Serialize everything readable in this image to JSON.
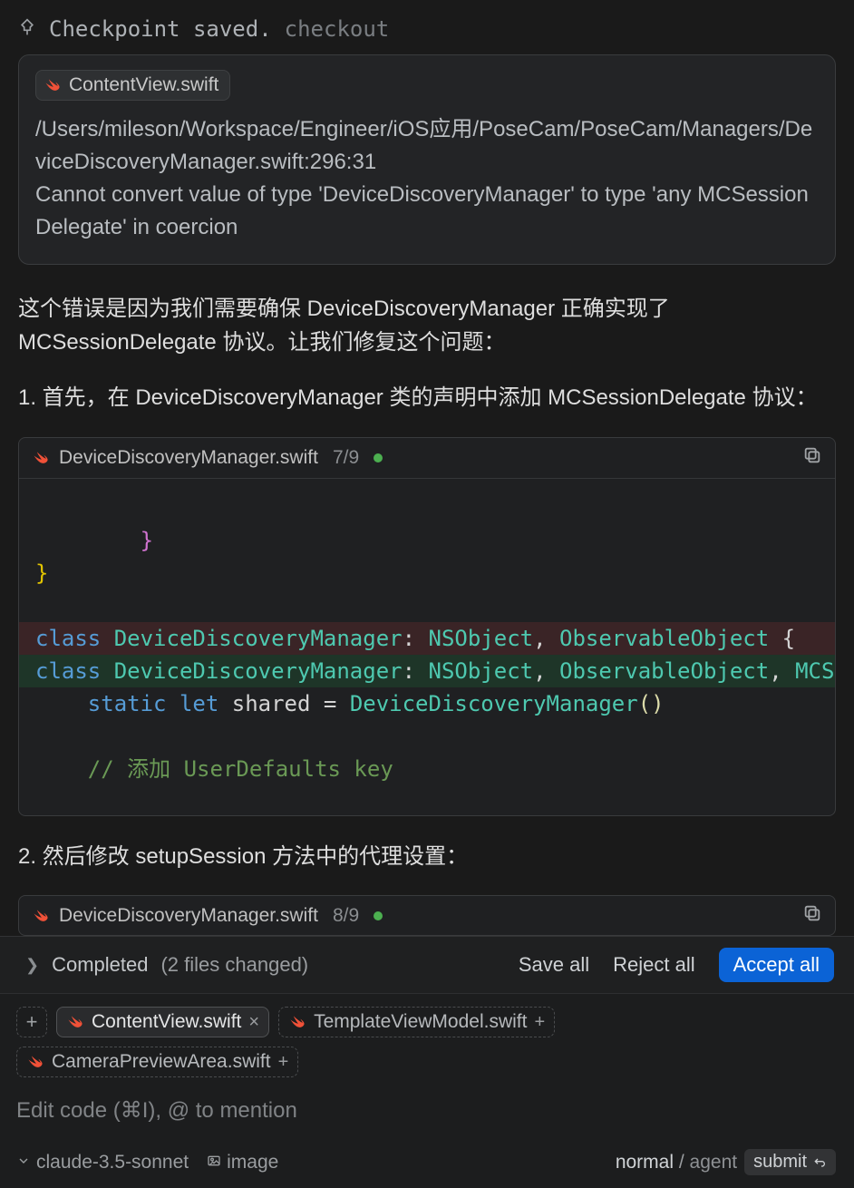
{
  "checkpoint": {
    "status": "Checkpoint saved.",
    "action": "checkout"
  },
  "error_card": {
    "file_badge": "ContentView.swift",
    "path_line": "/Users/mileson/Workspace/Engineer/iOS应用/PoseCam/PoseCam/Managers/DeviceDiscoveryManager.swift:296:31",
    "message": "Cannot convert value of type 'DeviceDiscoveryManager' to type 'any MCSessionDelegate' in coercion"
  },
  "explain_paragraph": "这个错误是因为我们需要确保 DeviceDiscoveryManager 正确实现了 MCSessionDelegate 协议。让我们修复这个问题：",
  "step1_text": "1. 首先，在 DeviceDiscoveryManager 类的声明中添加 MCSessionDelegate 协议：",
  "codebox1": {
    "filename": "DeviceDiscoveryManager.swift",
    "counter": "7/9",
    "code": {
      "l1": "        }",
      "l2": "}",
      "del": {
        "kw": "class ",
        "type1": "DeviceDiscoveryManager",
        "colon": ": ",
        "type2": "NSObject",
        "comma1": ", ",
        "type3": "ObservableObject",
        "brace": " {"
      },
      "add": {
        "kw": "class ",
        "type1": "DeviceDiscoveryManager",
        "colon": ": ",
        "type2": "NSObject",
        "comma1": ", ",
        "type3": "ObservableObject",
        "comma2": ", ",
        "type4": "MCSe"
      },
      "l5indent": "    ",
      "l5a": "static ",
      "l5b": "let ",
      "l5c": "shared",
      "l5d": " = ",
      "l5e": "DeviceDiscoveryManager",
      "l5f": "()",
      "l7indent": "    ",
      "l7": "// 添加 UserDefaults key"
    }
  },
  "step2_text": "2. 然后修改 setupSession 方法中的代理设置：",
  "codebox2": {
    "filename": "DeviceDiscoveryManager.swift",
    "counter": "8/9"
  },
  "completed_bar": {
    "label": "Completed",
    "detail": "(2 files changed)",
    "save_all": "Save all",
    "reject_all": "Reject all",
    "accept_all": "Accept all"
  },
  "input_area": {
    "chips": {
      "c1": "ContentView.swift",
      "c2": "TemplateViewModel.swift",
      "c3": "CameraPreviewArea.swift"
    },
    "placeholder": "Edit code (⌘I), @ to mention"
  },
  "footer": {
    "model": "claude-3.5-sonnet",
    "image_label": "image",
    "mode_normal": "normal",
    "mode_sep": " / ",
    "mode_agent": "agent",
    "submit": "submit"
  }
}
